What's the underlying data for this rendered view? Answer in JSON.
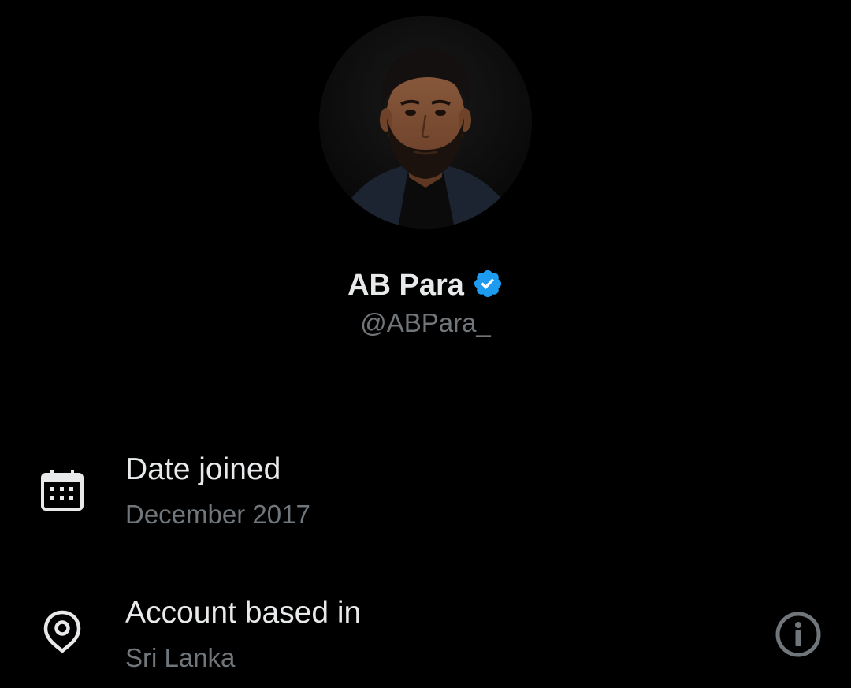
{
  "profile": {
    "display_name": "AB Para",
    "handle": "@ABPara_",
    "verified": true,
    "verified_color": "#1d9bf0",
    "avatar_icon": "profile-photo"
  },
  "details": {
    "date_joined": {
      "icon": "calendar-icon",
      "title": "Date joined",
      "value": "December 2017"
    },
    "account_based_in": {
      "icon": "location-pin-icon",
      "title": "Account based in",
      "value": "Sri Lanka",
      "action_icon": "info-icon"
    }
  },
  "colors": {
    "background": "#000000",
    "primary_text": "#e7e9ea",
    "secondary_text": "#71767b"
  }
}
